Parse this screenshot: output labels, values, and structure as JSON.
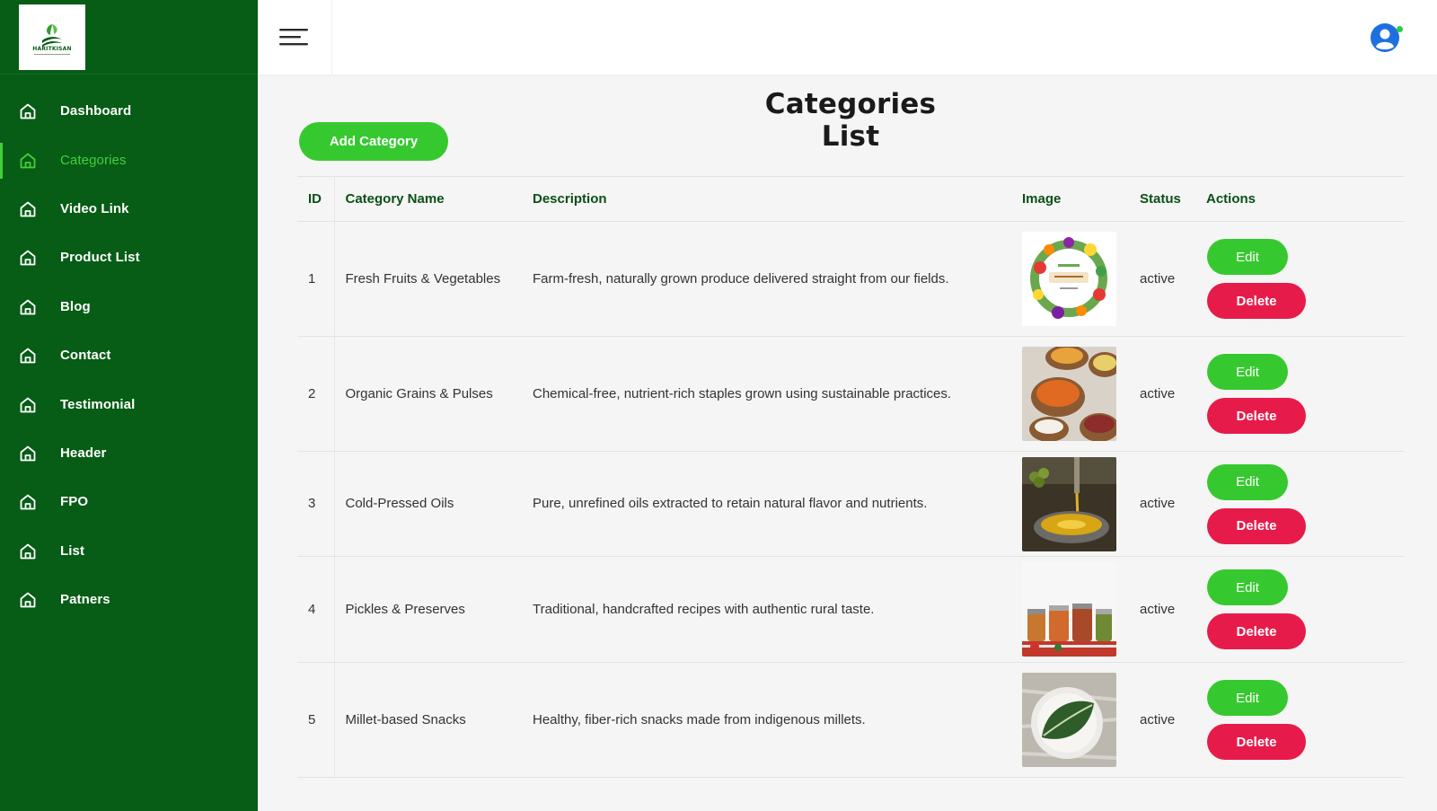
{
  "brand": {
    "logo_text": "HARITKISAN",
    "accent": "#36c92f",
    "sidebar_bg": "#075c16",
    "danger": "#e71b4a"
  },
  "sidebar": {
    "items": [
      {
        "label": "Dashboard",
        "icon": "home-icon",
        "active": false
      },
      {
        "label": "Categories",
        "icon": "home-icon",
        "active": true
      },
      {
        "label": "Video Link",
        "icon": "home-icon",
        "active": false
      },
      {
        "label": "Product List",
        "icon": "home-icon",
        "active": false
      },
      {
        "label": "Blog",
        "icon": "home-icon",
        "active": false
      },
      {
        "label": "Contact",
        "icon": "home-icon",
        "active": false
      },
      {
        "label": "Testimonial",
        "icon": "home-icon",
        "active": false
      },
      {
        "label": "Header",
        "icon": "home-icon",
        "active": false
      },
      {
        "label": "FPO",
        "icon": "home-icon",
        "active": false
      },
      {
        "label": "List",
        "icon": "home-icon",
        "active": false
      },
      {
        "label": "Patners",
        "icon": "home-icon",
        "active": false
      }
    ]
  },
  "topbar": {
    "menu_icon": "hamburger-icon",
    "avatar_icon": "user-avatar-icon",
    "online_status": "online"
  },
  "main": {
    "title": "Categories List",
    "add_button": "Add Category",
    "table": {
      "headers": [
        "ID",
        "Category Name",
        "Description",
        "Image",
        "Status",
        "Actions"
      ],
      "rows": [
        {
          "id": "1",
          "name": "Fresh Fruits & Vegetables",
          "description": "Farm-fresh, naturally grown produce delivered straight from our fields.",
          "image": "fruits-vegetables-wreath",
          "status": "active",
          "edit": "Edit",
          "delete": "Delete"
        },
        {
          "id": "2",
          "name": "Organic Grains & Pulses",
          "description": "Chemical-free, nutrient-rich staples grown using sustainable practices.",
          "image": "grains-pulses-bowls",
          "status": "active",
          "edit": "Edit",
          "delete": "Delete"
        },
        {
          "id": "3",
          "name": "Cold-Pressed Oils",
          "description": "Pure, unrefined oils extracted to retain natural flavor and nutrients.",
          "image": "oil-press-pot",
          "status": "active",
          "edit": "Edit",
          "delete": "Delete"
        },
        {
          "id": "4",
          "name": "Pickles & Preserves",
          "description": "Traditional, handcrafted recipes with authentic rural taste.",
          "image": "pickle-jars",
          "status": "active",
          "edit": "Edit",
          "delete": "Delete"
        },
        {
          "id": "5",
          "name": "Millet-based Snacks",
          "description": "Healthy, fiber-rich snacks made from indigenous millets.",
          "image": "leafy-greens-plate",
          "status": "active",
          "edit": "Edit",
          "delete": "Delete"
        }
      ]
    }
  }
}
